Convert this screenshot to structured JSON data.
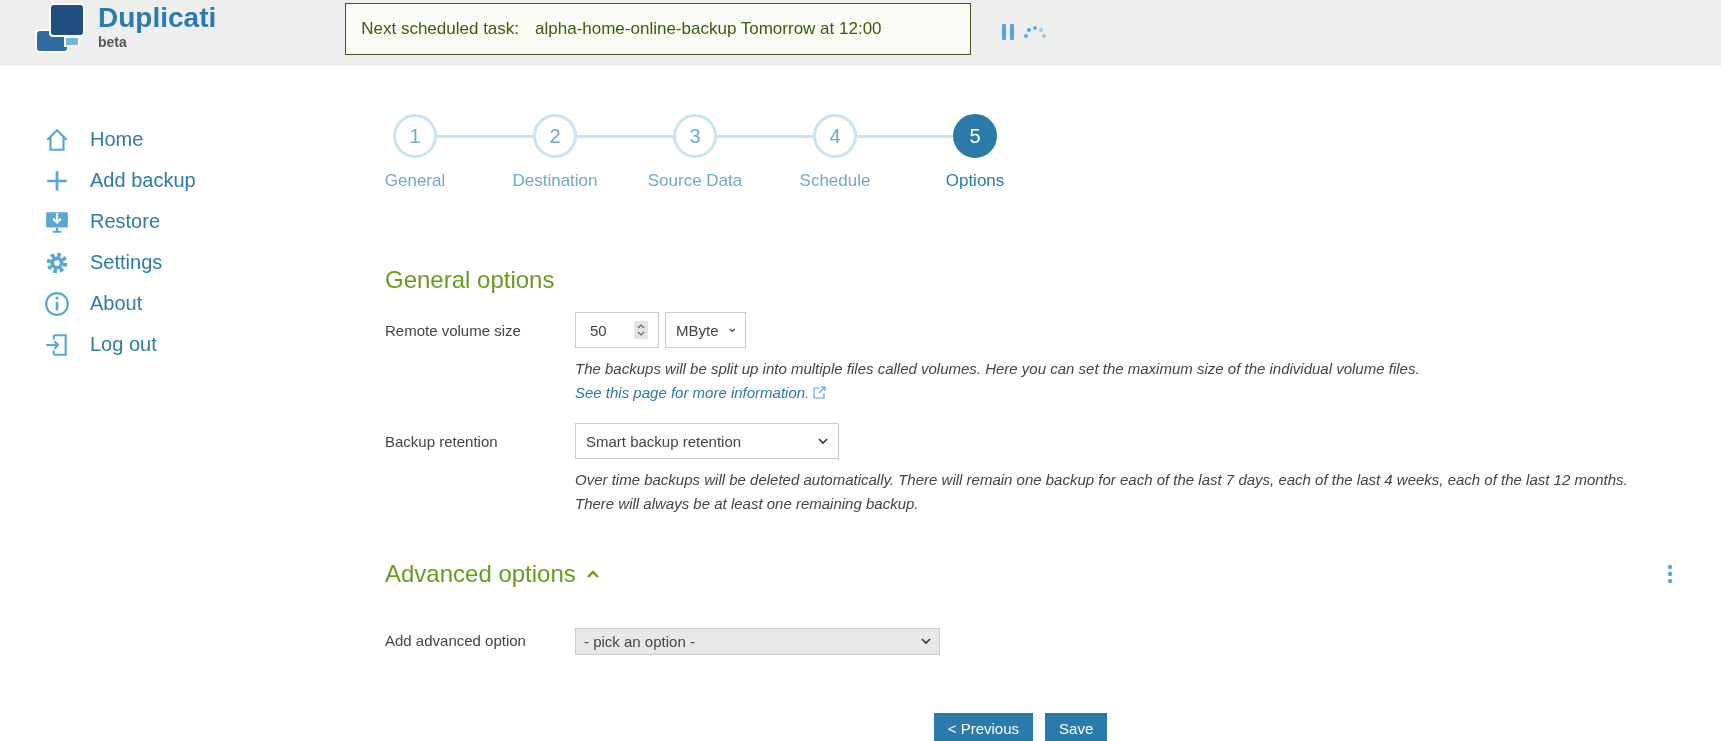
{
  "header": {
    "logo_title": "Duplicati",
    "logo_subtitle": "beta",
    "scheduled": {
      "label": "Next scheduled task:",
      "value": "alpha-home-online-backup Tomorrow at 12:00"
    }
  },
  "sidebar": {
    "items": [
      {
        "label": "Home",
        "kind": "home"
      },
      {
        "label": "Add backup",
        "kind": "add"
      },
      {
        "label": "Restore",
        "kind": "restore"
      },
      {
        "label": "Settings",
        "kind": "settings"
      },
      {
        "label": "About",
        "kind": "about"
      },
      {
        "label": "Log out",
        "kind": "logout"
      }
    ]
  },
  "steps": [
    {
      "number": "1",
      "label": "General",
      "selected": false
    },
    {
      "number": "2",
      "label": "Destination",
      "selected": false
    },
    {
      "number": "3",
      "label": "Source Data",
      "selected": false
    },
    {
      "number": "4",
      "label": "Schedule",
      "selected": false
    },
    {
      "number": "5",
      "label": "Options",
      "selected": true
    }
  ],
  "general_options": {
    "title": "General options",
    "fields": [
      {
        "kind": "size",
        "label": "Remote volume size",
        "value": "50",
        "unit": "MByte",
        "help": "The backups will be split up into multiple files called volumes. Here you can set the maximum size of the individual volume files.",
        "link": "See this page for more information."
      },
      {
        "kind": "select",
        "label": "Backup retention",
        "value": "Smart backup retention",
        "help": "Over time backups will be deleted automatically. There will remain one backup for each of the last 7 days, each of the last 4 weeks, each of the last 12 months. There will always be at least one remaining backup."
      }
    ]
  },
  "advanced_options": {
    "title": "Advanced options",
    "expanded": true,
    "field": {
      "label": "Add advanced option",
      "placeholder": "- pick an option -"
    }
  },
  "buttons": [
    {
      "label": "< Previous"
    },
    {
      "label": "Save"
    }
  ]
}
